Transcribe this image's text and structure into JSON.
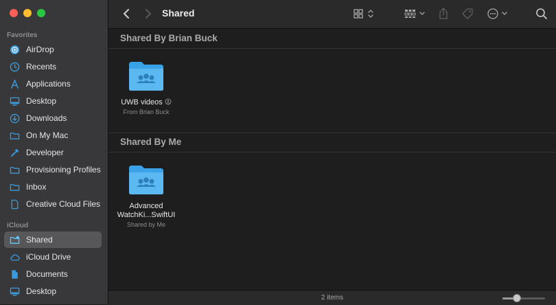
{
  "window": {
    "title": "Shared"
  },
  "sidebar": {
    "favorites_label": "Favorites",
    "icloud_label": "iCloud",
    "favorites": [
      {
        "label": "AirDrop",
        "icon": "airdrop-icon"
      },
      {
        "label": "Recents",
        "icon": "clock-icon"
      },
      {
        "label": "Applications",
        "icon": "applications-icon"
      },
      {
        "label": "Desktop",
        "icon": "desktop-icon"
      },
      {
        "label": "Downloads",
        "icon": "download-icon"
      },
      {
        "label": "On My Mac",
        "icon": "folder-icon"
      },
      {
        "label": "Developer",
        "icon": "hammer-icon"
      },
      {
        "label": "Provisioning Profiles",
        "icon": "folder-icon"
      },
      {
        "label": "Inbox",
        "icon": "folder-icon"
      },
      {
        "label": "Creative Cloud Files",
        "icon": "document-icon"
      }
    ],
    "icloud": [
      {
        "label": "Shared",
        "icon": "shared-folder-icon",
        "selected": true
      },
      {
        "label": "iCloud Drive",
        "icon": "cloud-icon"
      },
      {
        "label": "Documents",
        "icon": "document-icon"
      },
      {
        "label": "Desktop",
        "icon": "desktop-icon"
      }
    ]
  },
  "groups": [
    {
      "title": "Shared By Brian Buck",
      "items": [
        {
          "name": "UWB videos",
          "subtitle": "From Brian Buck"
        }
      ]
    },
    {
      "title": "Shared By Me",
      "items": [
        {
          "name_line1": "Advanced",
          "name_line2": "WatchKi...SwiftUI",
          "subtitle": "Shared by Me"
        }
      ]
    }
  ],
  "status": {
    "item_count": "2 items",
    "zoom_fraction": 0.3
  },
  "colors": {
    "accent": "#3aa3e8",
    "folder": "#5cb8f0",
    "sidebar_icon": "#3a9bdc"
  }
}
